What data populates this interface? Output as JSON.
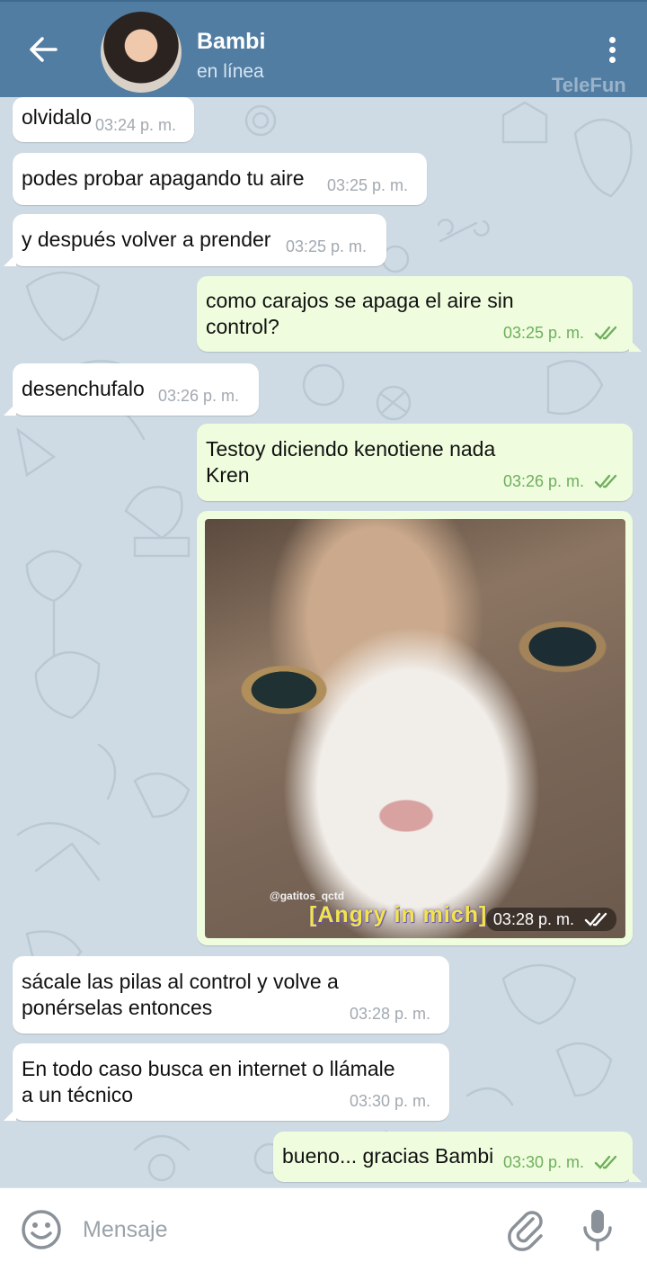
{
  "header": {
    "title": "Bambi",
    "status": "en línea",
    "watermark": "TeleFun",
    "back_icon": "arrow-left-icon",
    "menu_icon": "more-vertical-icon"
  },
  "messages": [
    {
      "dir": "in",
      "text": "olvidalo",
      "time": "03:24 p. m."
    },
    {
      "dir": "in",
      "text": "podes probar apagando tu aire",
      "time": "03:25 p. m."
    },
    {
      "dir": "in",
      "text": "y después volver a prender",
      "time": "03:25 p. m."
    },
    {
      "dir": "out",
      "line1": "como carajos se apaga el aire sin",
      "line2": "control?",
      "time": "03:25 p. m."
    },
    {
      "dir": "in",
      "text": "desenchufalo",
      "time": "03:26 p. m."
    },
    {
      "dir": "out",
      "line1": "Testoy diciendo kenotiene nada",
      "line2": "Kren",
      "time": "03:26 p. m."
    },
    {
      "dir": "out",
      "type": "photo",
      "caption_small": "@gatitos_qctd",
      "caption_big": "[Angry in mich]",
      "time": "03:28 p. m."
    },
    {
      "dir": "in",
      "line1": "sácale las pilas al control y volve a",
      "line2": "ponérselas entonces",
      "time": "03:28 p. m."
    },
    {
      "dir": "in",
      "line1": "En todo caso busca en internet o llámale",
      "line2": "a un técnico",
      "time": "03:30 p. m."
    },
    {
      "dir": "out",
      "text": "bueno... gracias Bambi",
      "time": "03:30 p. m."
    }
  ],
  "input": {
    "placeholder": "Mensaje",
    "emoji_icon": "smiley-icon",
    "attach_icon": "paperclip-icon",
    "mic_icon": "microphone-icon"
  },
  "colors": {
    "header": "#517da2",
    "chat_background": "#cfdbe4",
    "incoming_bubble": "#ffffff",
    "outgoing_bubble": "#effdde",
    "read_check": "#6fae5c"
  }
}
